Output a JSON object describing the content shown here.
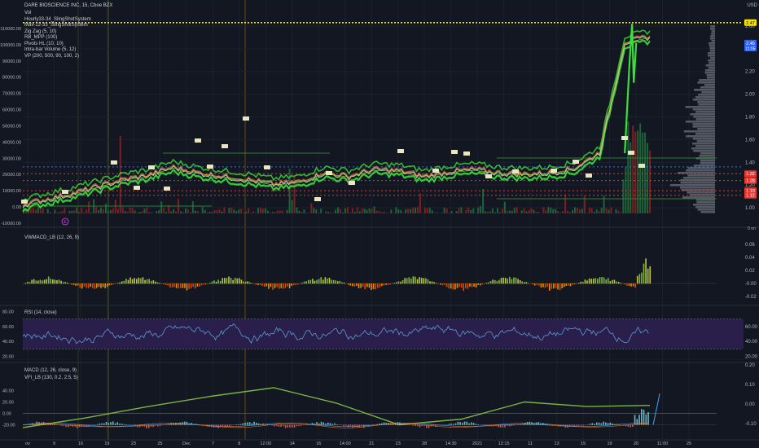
{
  "header": {
    "symbol_line": "DARE BIOSCIENCE INC, 15, Cboe BZX",
    "currency": "USD",
    "indicators": [
      "Vol",
      "Hourly33-34_SlingShotSystem",
      "Mav-12-33_SlingShotSystem",
      "Zig Zag (5, 10)",
      "RB_MPP (100)",
      "Pivots HL (10, 10)",
      "Intra-bar Volume (5, 12)",
      "VP (200, 500, 90, 100, 2)"
    ]
  },
  "panes": {
    "vwmacd_title": "VWMACD_LB (12, 26, 9)",
    "rsi_title": "RSI (14, close)",
    "macd_title": "MACD (12, 26, close, 9)",
    "vfi_title": "VFI_LB (130, 0.2, 2.5, 5)"
  },
  "colors": {
    "background": "#131722",
    "up": "#26a69a",
    "down": "#ef5350",
    "bright_green": "#3adf3a",
    "rsi_line": "#5b9bd5",
    "rsi_fill": "#2a1f4a",
    "price_badge": "#2962ff",
    "yellow": "#f5e300"
  },
  "chart_data": [
    {
      "type": "line",
      "title": "DARE BIOSCIENCE INC, 15, Cboe BZX",
      "x_tick_labels": [
        "ov",
        "9",
        "16",
        "19",
        "23",
        "25",
        "Dec",
        "7",
        "8",
        "12:00",
        "14",
        "16",
        "14:00",
        "21",
        "23",
        "28",
        "14:30",
        "2021",
        "12:15",
        "11",
        "13",
        "15",
        "19",
        "20",
        "11:00",
        "26"
      ],
      "price_axis": {
        "labels": [
          "2.60",
          "2.40",
          "2.20",
          "2.00",
          "1.80",
          "1.60",
          "1.40",
          "1.20",
          "1.00"
        ],
        "range": [
          0.95,
          2.65
        ],
        "unit": "USD"
      },
      "volume_axis": {
        "labels": [
          "110000.00",
          "100000.00",
          "90000.00",
          "80000.00",
          "70000.00",
          "60000.00",
          "50000.00",
          "40000.00",
          "30000.00",
          "20000.00",
          "10000.00",
          "0.00",
          "-10000.00"
        ],
        "range": [
          -10000,
          115000
        ]
      },
      "series": [
        {
          "name": "close",
          "x": [
            0,
            4,
            8,
            12,
            16,
            20,
            24,
            28,
            32,
            36,
            40,
            44,
            48,
            52,
            56,
            60,
            64,
            68,
            72,
            76,
            80,
            84,
            88,
            92,
            96,
            100
          ],
          "values": [
            1.02,
            1.07,
            1.12,
            1.18,
            1.24,
            1.28,
            1.35,
            1.3,
            1.27,
            1.24,
            1.2,
            1.22,
            1.3,
            1.27,
            1.33,
            1.32,
            1.27,
            1.31,
            1.33,
            1.3,
            1.29,
            1.3,
            1.34,
            1.48,
            2.45,
            2.5
          ]
        }
      ],
      "horizontal_levels": [
        {
          "label": "2.47",
          "value": 2.63,
          "style": "yellow-dotted"
        },
        {
          "label": "1.32",
          "value": 1.3,
          "style": "red-dotted"
        },
        {
          "label": "1.28",
          "value": 1.24,
          "style": "red-dotted"
        },
        {
          "label": "1.19",
          "value": 1.15,
          "style": "red-dotted"
        },
        {
          "label": "1.12",
          "value": 1.11,
          "style": "red-dotted"
        },
        {
          "label": "",
          "value": 1.36,
          "style": "blue-dotted"
        }
      ],
      "last_price": {
        "label": "2.45",
        "sublabel": "11:05",
        "value": 2.45
      }
    },
    {
      "type": "bar",
      "title": "VWMACD_LB (12, 26, 9)",
      "y_tick_labels": [
        "0.06",
        "0.04",
        "0.02",
        "-0.00",
        "-0.02"
      ],
      "ylim": [
        -0.025,
        0.07
      ]
    },
    {
      "type": "line",
      "title": "RSI (14, close)",
      "y_tick_labels": [
        "80.00",
        "60.00",
        "40.00",
        "20.00"
      ],
      "ylim": [
        15,
        85
      ],
      "band": [
        30,
        70
      ],
      "right_labels": [
        "60.00",
        "40.00",
        "20.00"
      ]
    },
    {
      "type": "line",
      "title": "MACD (12, 26, close, 9) / VFI_LB (130, 0.2, 2.5, 5)",
      "y_tick_labels": [
        "40.00",
        "20.00",
        "0.00",
        "-20.00"
      ],
      "right_labels": [
        "0.20",
        "0.10",
        "0.00",
        "-0.10"
      ],
      "series": [
        {
          "name": "VFI",
          "x": [
            0,
            10,
            20,
            30,
            40,
            50,
            60,
            70,
            80,
            90,
            100
          ],
          "values": [
            -25,
            -8,
            12,
            30,
            45,
            18,
            -20,
            -10,
            20,
            12,
            14
          ]
        }
      ]
    }
  ],
  "markers": {
    "earnings_badge": "E"
  }
}
